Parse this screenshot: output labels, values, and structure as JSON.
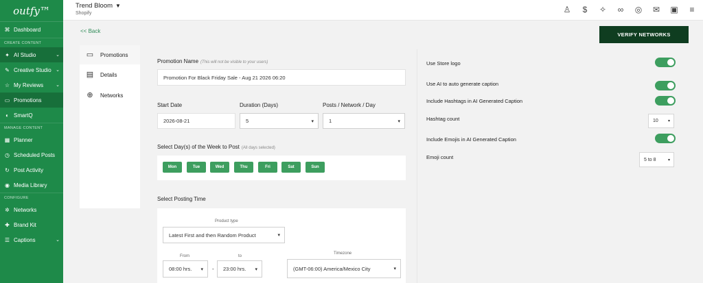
{
  "app": {
    "logo": "outfy™"
  },
  "store": {
    "name": "Trend Bloom",
    "platform": "Shopify"
  },
  "sidebar": {
    "sections": {
      "create": "CREATE CONTENT",
      "manage": "MANAGE CONTENT",
      "configure": "CONFIGURE"
    },
    "items": [
      {
        "label": "Dashboard",
        "icon": "dashboard-icon"
      },
      {
        "label": "AI Studio",
        "icon": "ai-studio-icon"
      },
      {
        "label": "Creative Studio",
        "icon": "creative-studio-icon"
      },
      {
        "label": "My Reviews",
        "icon": "reviews-icon"
      },
      {
        "label": "Promotions",
        "icon": "promotions-icon"
      },
      {
        "label": "SmartQ",
        "icon": "smartq-icon"
      },
      {
        "label": "Planner",
        "icon": "planner-icon"
      },
      {
        "label": "Scheduled Posts",
        "icon": "scheduled-posts-icon"
      },
      {
        "label": "Post Activity",
        "icon": "post-activity-icon"
      },
      {
        "label": "Media Library",
        "icon": "media-library-icon"
      },
      {
        "label": "Networks",
        "icon": "networks-icon"
      },
      {
        "label": "Brand Kit",
        "icon": "brand-kit-icon"
      },
      {
        "label": "Captions",
        "icon": "captions-icon"
      }
    ]
  },
  "nav": {
    "back": "<< Back",
    "verify": "VERIFY NETWORKS"
  },
  "tabs": [
    {
      "label": "Promotions",
      "icon": "promotions-icon"
    },
    {
      "label": "Details",
      "icon": "details-icon"
    },
    {
      "label": "Networks",
      "icon": "globe-icon"
    }
  ],
  "form": {
    "promotion_name_label": "Promotion Name",
    "promotion_name_note": "(This will not be visible to your users)",
    "promotion_name_value": "Promotion For Black Friday Sale - Aug 21 2026 06:20",
    "start_date_label": "Start Date",
    "start_date_value": "2026-08-21",
    "duration_label": "Duration (Days)",
    "duration_value": "5",
    "posts_label": "Posts / Network / Day",
    "posts_value": "1",
    "days_label": "Select Day(s) of the Week to Post",
    "days_note": "(All days selected)",
    "days": [
      "Mon",
      "Tue",
      "Wed",
      "Thu",
      "Fri",
      "Sat",
      "Sun"
    ],
    "posting_time_label": "Select Posting Time",
    "product_type_label": "Product type",
    "product_type_value": "Latest First and then Random Product",
    "from_label": "From",
    "from_value": "08:00 hrs.",
    "separator": "-",
    "to_label": "to",
    "to_value": "23:00 hrs.",
    "timezone_label": "Timezone",
    "timezone_value": "(GMT-06:00) America/Mexico City"
  },
  "settings": {
    "use_store_logo": "Use Store logo",
    "ai_caption": "Use AI to auto generate caption",
    "include_hashtags": "Include Hashtags in AI Generated Caption",
    "hashtag_count_label": "Hashtag count",
    "hashtag_count_value": "10",
    "include_emojis": "Include Emojis in AI Generated Caption",
    "emoji_count_label": "Emoji count",
    "emoji_count_value": "5 to 8"
  },
  "colors": {
    "sidebar": "#1e8a49",
    "accent": "#3d9e5f",
    "verify": "#0f3d20"
  }
}
